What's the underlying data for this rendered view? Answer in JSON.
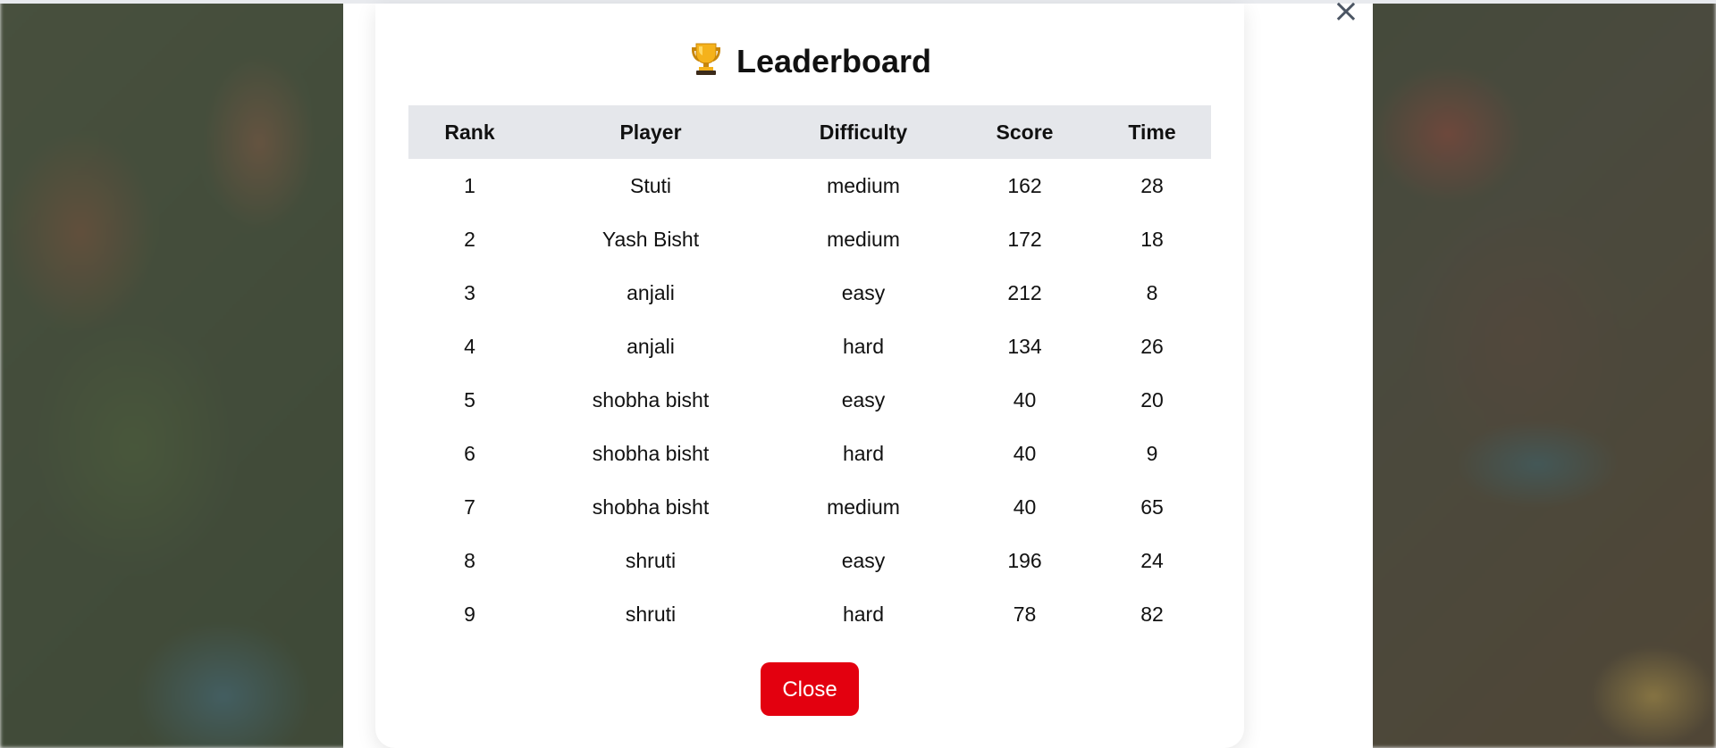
{
  "modal": {
    "title": "Leaderboard",
    "title_icon": "trophy-icon",
    "close_icon": "close-icon",
    "close_button_label": "Close",
    "accent_color": "#e3000f"
  },
  "table": {
    "headers": {
      "rank": "Rank",
      "player": "Player",
      "difficulty": "Difficulty",
      "score": "Score",
      "time": "Time"
    },
    "rows": [
      {
        "rank": "1",
        "player": "Stuti",
        "difficulty": "medium",
        "score": "162",
        "time": "28"
      },
      {
        "rank": "2",
        "player": "Yash Bisht",
        "difficulty": "medium",
        "score": "172",
        "time": "18"
      },
      {
        "rank": "3",
        "player": "anjali",
        "difficulty": "easy",
        "score": "212",
        "time": "8"
      },
      {
        "rank": "4",
        "player": "anjali",
        "difficulty": "hard",
        "score": "134",
        "time": "26"
      },
      {
        "rank": "5",
        "player": "shobha bisht",
        "difficulty": "easy",
        "score": "40",
        "time": "20"
      },
      {
        "rank": "6",
        "player": "shobha bisht",
        "difficulty": "hard",
        "score": "40",
        "time": "9"
      },
      {
        "rank": "7",
        "player": "shobha bisht",
        "difficulty": "medium",
        "score": "40",
        "time": "65"
      },
      {
        "rank": "8",
        "player": "shruti",
        "difficulty": "easy",
        "score": "196",
        "time": "24"
      },
      {
        "rank": "9",
        "player": "shruti",
        "difficulty": "hard",
        "score": "78",
        "time": "82"
      }
    ]
  }
}
